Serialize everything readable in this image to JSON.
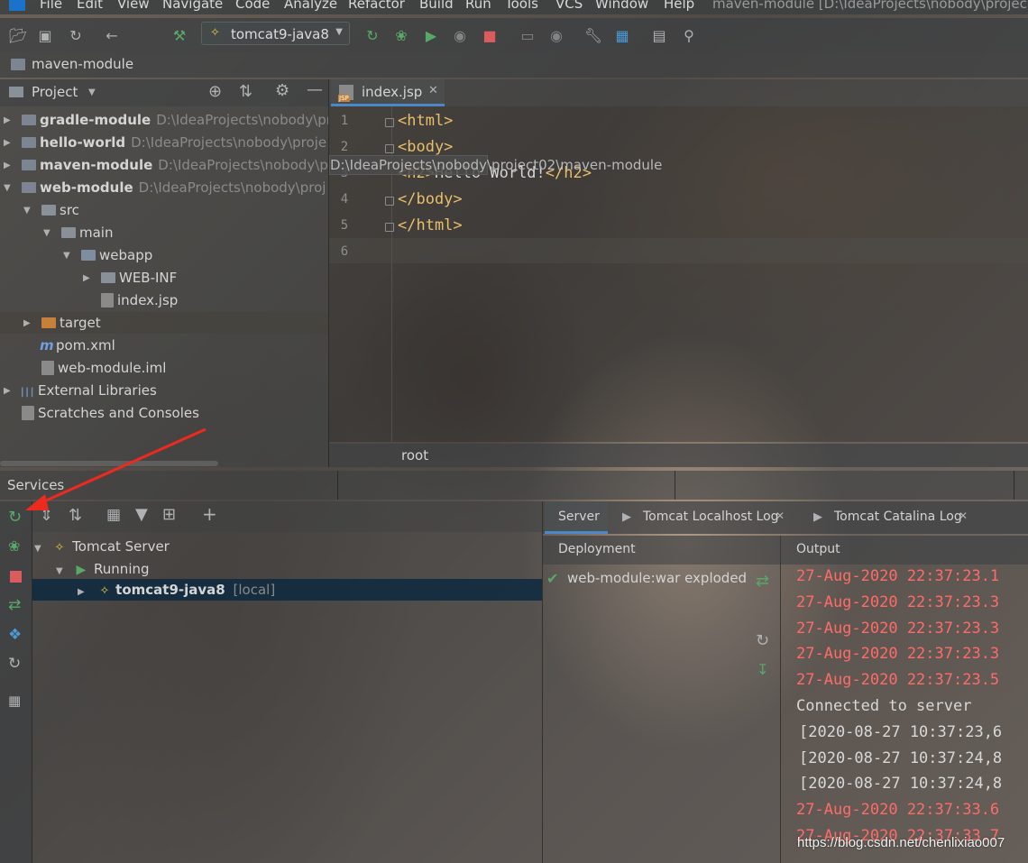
{
  "menu": {
    "items": [
      "File",
      "Edit",
      "View",
      "Navigate",
      "Code",
      "Analyze",
      "Refactor",
      "Build",
      "Run",
      "Tools",
      "VCS",
      "Window",
      "Help"
    ],
    "window_title": "maven-module [D:\\IdeaProjects\\nobody\\projec"
  },
  "toolbar": {
    "run_config": "tomcat9-java8",
    "icons": [
      "folder-open-icon",
      "save-icon",
      "sync-icon",
      "back-icon",
      "build-hammer-icon",
      "rerun-icon",
      "debug-icon",
      "coverage-icon",
      "profile-icon",
      "stop-icon",
      "device-icon",
      "attach-icon",
      "settings-wrench-icon",
      "project-structure-icon",
      "terminal-icon",
      "search-icon"
    ]
  },
  "navbar": {
    "breadcrumb": "maven-module"
  },
  "project": {
    "header_label": "Project",
    "tree": [
      {
        "label": "gradle-module",
        "path": "D:\\IdeaProjects\\nobody\\pr",
        "indent": 0,
        "arrow": "▶",
        "icon": "module",
        "bold": true
      },
      {
        "label": "hello-world",
        "path": "D:\\IdeaProjects\\nobody\\proje",
        "indent": 0,
        "arrow": "▶",
        "icon": "module",
        "bold": true
      },
      {
        "label": "maven-module",
        "path": "D:\\IdeaProjects\\nobody\\project02\\maven-module",
        "indent": 0,
        "arrow": "▶",
        "icon": "module",
        "bold": true
      },
      {
        "label": "web-module",
        "path": "D:\\IdeaProjects\\nobody\\proj",
        "indent": 0,
        "arrow": "▼",
        "icon": "module",
        "bold": true
      },
      {
        "label": "src",
        "path": "",
        "indent": 1,
        "arrow": "▼",
        "icon": "folder",
        "bold": false
      },
      {
        "label": "main",
        "path": "",
        "indent": 2,
        "arrow": "▼",
        "icon": "folder",
        "bold": false
      },
      {
        "label": "webapp",
        "path": "",
        "indent": 3,
        "arrow": "▼",
        "icon": "webfolder",
        "bold": false
      },
      {
        "label": "WEB-INF",
        "path": "",
        "indent": 4,
        "arrow": "▶",
        "icon": "folder",
        "bold": false
      },
      {
        "label": "index.jsp",
        "path": "",
        "indent": 4,
        "arrow": "",
        "icon": "jsp",
        "bold": false
      },
      {
        "label": "target",
        "path": "",
        "indent": 1,
        "arrow": "▶",
        "icon": "orange",
        "bold": false
      },
      {
        "label": "pom.xml",
        "path": "",
        "indent": 1,
        "arrow": "",
        "icon": "maven",
        "bold": false
      },
      {
        "label": "web-module.iml",
        "path": "",
        "indent": 1,
        "arrow": "",
        "icon": "iml",
        "bold": false
      },
      {
        "label": "External Libraries",
        "path": "",
        "indent": 0,
        "arrow": "▶",
        "icon": "libs",
        "bold": false
      },
      {
        "label": "Scratches and Consoles",
        "path": "",
        "indent": 0,
        "arrow": "",
        "icon": "scratch",
        "bold": false
      }
    ]
  },
  "editor": {
    "tab_label": "index.jsp",
    "tab_badge": "JSP",
    "lines": [
      {
        "num": "1",
        "parts": [
          [
            "tag",
            "<html>"
          ]
        ]
      },
      {
        "num": "2",
        "parts": [
          [
            "tag",
            "<body>"
          ]
        ]
      },
      {
        "num": "3",
        "parts": [
          [
            "tag",
            "<h2>"
          ],
          [
            "txt",
            "Hello World!"
          ],
          [
            "tag",
            "</h2>"
          ]
        ]
      },
      {
        "num": "4",
        "parts": [
          [
            "tag",
            "</body>"
          ]
        ]
      },
      {
        "num": "5",
        "parts": [
          [
            "tag",
            "</html>"
          ]
        ]
      },
      {
        "num": "6",
        "parts": []
      }
    ],
    "tooltip": "D:\\IdeaProjects\\nobody\\project02\\maven-module",
    "breadcrumb": "root"
  },
  "services": {
    "title": "Services",
    "tree": {
      "server": "Tomcat Server",
      "state": "Running",
      "config": "tomcat9-java8",
      "config_tag": "[local]"
    },
    "tabs": [
      "Server",
      "Tomcat Localhost Log",
      "Tomcat Catalina Log"
    ],
    "deployment_header": "Deployment",
    "deployment_item": "web-module:war exploded",
    "output_header": "Output",
    "output_lines": [
      {
        "text": "27-Aug-2020 22:37:23.1",
        "kind": "red"
      },
      {
        "text": "27-Aug-2020 22:37:23.3",
        "kind": "red"
      },
      {
        "text": "27-Aug-2020 22:37:23.3",
        "kind": "red"
      },
      {
        "text": "27-Aug-2020 22:37:23.3",
        "kind": "red"
      },
      {
        "text": "27-Aug-2020 22:37:23.5",
        "kind": "red"
      },
      {
        "text": "Connected to server",
        "kind": "normal"
      },
      {
        "text": "[2020-08-27 10:37:23,6",
        "kind": "normal"
      },
      {
        "text": "[2020-08-27 10:37:24,8",
        "kind": "normal"
      },
      {
        "text": "[2020-08-27 10:37:24,8",
        "kind": "normal"
      },
      {
        "text": "27-Aug-2020 22:37:33.6",
        "kind": "red"
      },
      {
        "text": "27-Aug-2020 22:37:33.7",
        "kind": "red"
      }
    ]
  },
  "watermark": "https://blog.csdn.net/chenlixiao007",
  "colors": {
    "tag": "#e8bf6a",
    "error": "#ff6b68",
    "run_green": "#59a869",
    "stop_red": "#db5c5c",
    "annotation": "#ee2a1f"
  }
}
